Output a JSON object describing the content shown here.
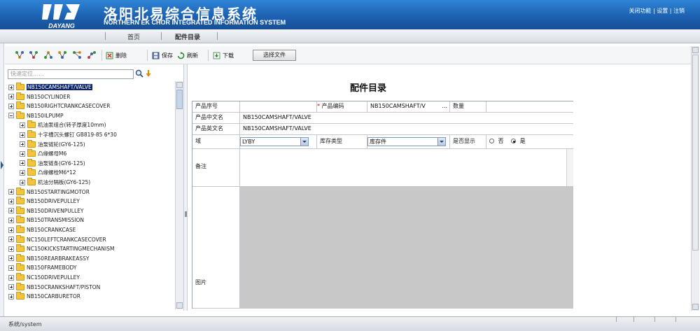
{
  "header": {
    "logo_text": "DAYANG",
    "title_cn": "洛阳北易综合信息系统",
    "title_en": "NORTHERN EK CHOR INTEGRATED INFORMATION SYSTEM",
    "links": [
      "关闭功能",
      "设置",
      "注销"
    ],
    "link_sep": " | "
  },
  "nav": {
    "tabs": [
      "首页",
      "配件目录"
    ]
  },
  "toolbar": {
    "delete_label": "删除",
    "save_label": "保存",
    "refresh_label": "刷新",
    "download_label": "下载",
    "choose_file_label": "选择文件"
  },
  "tree": {
    "search_placeholder": "快速定位……",
    "items": [
      {
        "label": "NB150CAMSHAFT/VALVE",
        "level": 0,
        "expander": "plus",
        "selected": true
      },
      {
        "label": "NB150CYLINDER",
        "level": 0,
        "expander": "plus"
      },
      {
        "label": "NB150RIGHTCRANKCASECOVER",
        "level": 0,
        "expander": "plus"
      },
      {
        "label": "NB150ILPUMP",
        "level": 0,
        "expander": "minus"
      },
      {
        "label": "机油泵组合(转子厚度10mm)",
        "level": 1,
        "expander": "plus"
      },
      {
        "label": "十字槽沉头螺钉 GB819-85 6*30",
        "level": 1,
        "expander": "plus"
      },
      {
        "label": "油泵链轮(GY6-125)",
        "level": 1,
        "expander": "plus"
      },
      {
        "label": "凸缘螺母M6",
        "level": 1,
        "expander": "plus"
      },
      {
        "label": "油泵链条(GY6-125)",
        "level": 1,
        "expander": "plus"
      },
      {
        "label": "凸缘螺栓M6*12",
        "level": 1,
        "expander": "plus"
      },
      {
        "label": "机油分隔板(GY6-125)",
        "level": 1,
        "expander": "plus"
      },
      {
        "label": "NB150STARTINGMOTOR",
        "level": 0,
        "expander": "plus"
      },
      {
        "label": "NB150DRIVEPULLEY",
        "level": 0,
        "expander": "plus"
      },
      {
        "label": "NB150DRIVENPULLEY",
        "level": 0,
        "expander": "plus"
      },
      {
        "label": "NB150TRANSMISSION",
        "level": 0,
        "expander": "plus"
      },
      {
        "label": "NB150CRANKCASE",
        "level": 0,
        "expander": "plus"
      },
      {
        "label": "NC150LEFTCRANKCASECOVER",
        "level": 0,
        "expander": "plus"
      },
      {
        "label": "NC150KICKSTARTINGMECHANISM",
        "level": 0,
        "expander": "plus"
      },
      {
        "label": "NB150REARBRAKEASSY",
        "level": 0,
        "expander": "plus"
      },
      {
        "label": "NB150FRAMEBODY",
        "level": 0,
        "expander": "plus"
      },
      {
        "label": "NC150DRIVEPULLEY",
        "level": 0,
        "expander": "plus"
      },
      {
        "label": "NB150CRANKSHAFT/PISTON",
        "level": 0,
        "expander": "plus"
      },
      {
        "label": "NB150CARBURETOR",
        "level": 0,
        "expander": "plus"
      }
    ]
  },
  "form": {
    "title": "配件目录",
    "product_no_label": "产品序号",
    "product_no_value": "",
    "required_mark": "*",
    "product_code_label": "产品编码",
    "product_code_value": "NB150CAMSHAFT/V",
    "product_code_btn": "...",
    "quantity_label": "数量",
    "quantity_value": "",
    "cn_name_label": "产品中文名",
    "cn_name_value": "NB150CAMSHAFT/VALVE",
    "en_name_label": "产品英文名",
    "en_name_value": "NB150CAMSHAFT/VALVE",
    "domain_label": "域",
    "domain_value": "LYBY",
    "stock_type_label": "库存类型",
    "stock_type_value": "库存件",
    "display_label": "是否显示",
    "display_no": "否",
    "display_yes": "是",
    "display_selected": "是",
    "remark_label": "备注",
    "image_label": "图片"
  },
  "status": {
    "text": "系统/system"
  },
  "colors": {
    "header": "#1b5fae",
    "selected": "#0a246a",
    "image_bg": "#c8c8c8"
  }
}
